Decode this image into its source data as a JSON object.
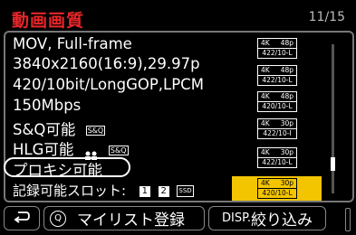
{
  "header": {
    "title": "動画画質",
    "page_indicator": "11/15"
  },
  "list": {
    "items": [
      {
        "label": "MOV, Full-frame"
      },
      {
        "label": "3840x2160(16:9),29.97p"
      },
      {
        "label": "420/10bit/LongGOP,LPCM"
      },
      {
        "label": "150Mbps"
      },
      {
        "label": "S&Q可能",
        "badge": "S&Q"
      },
      {
        "label": "HLG可能",
        "badge": "S&Q"
      },
      {
        "label": "プロキシ可能"
      },
      {
        "label": "記録可能スロット:",
        "slot1": "1",
        "slot2": "2",
        "slot_ssd": "SSD"
      }
    ]
  },
  "thumbs": [
    {
      "res": "4K",
      "fps": "48p",
      "codec": "422/10-L"
    },
    {
      "res": "4K",
      "fps": "48p",
      "codec": "422/10-L"
    },
    {
      "res": "4K",
      "fps": "48p",
      "codec": "420/10-L"
    },
    {
      "res": "4K",
      "fps": "30p",
      "codec": "422/10-I"
    },
    {
      "res": "4K",
      "fps": "30p",
      "codec": "422/10-L"
    },
    {
      "res": "4K",
      "fps": "30p",
      "codec": "420/10-L"
    }
  ],
  "footer": {
    "back_icon": "back-arrow-icon",
    "my_list_q": "Q",
    "my_list_label": "マイリスト登録",
    "disp_prefix": "DISP.",
    "disp_label": "絞り込み"
  },
  "colors": {
    "title": "#e8262a",
    "selection": "#f2c500"
  }
}
